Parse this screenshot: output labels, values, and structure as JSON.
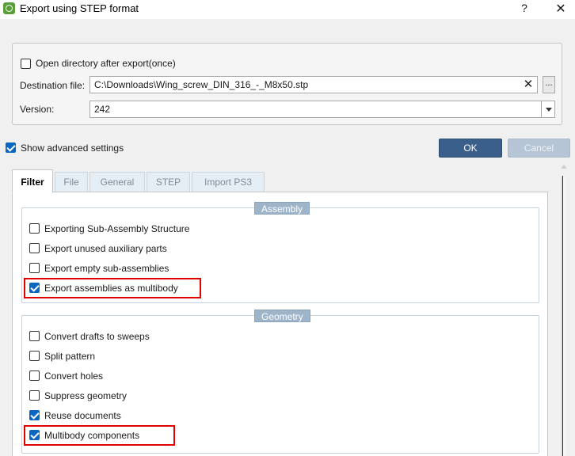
{
  "window": {
    "title": "Export using STEP format",
    "help_label": "?",
    "close_label": "✕"
  },
  "top": {
    "open_dir_label": "Open directory after export(once)",
    "open_dir_checked": false,
    "dest_label": "Destination file:",
    "dest_value": "C:\\Downloads\\Wing_screw_DIN_316_-_M8x50.stp",
    "clear_label": "✕",
    "browse_label": "...",
    "version_label": "Version:",
    "version_value": "242"
  },
  "advanced": {
    "label": "Show advanced settings",
    "checked": true
  },
  "buttons": {
    "ok": "OK",
    "cancel": "Cancel"
  },
  "tabs": [
    {
      "label": "Filter",
      "active": true
    },
    {
      "label": "File",
      "active": false
    },
    {
      "label": "General",
      "active": false
    },
    {
      "label": "STEP",
      "active": false
    },
    {
      "label": "Import PS3",
      "active": false
    }
  ],
  "assembly": {
    "title": "Assembly",
    "options": [
      {
        "label": "Exporting Sub-Assembly Structure",
        "checked": false
      },
      {
        "label": "Export unused auxiliary parts",
        "checked": false
      },
      {
        "label": "Export empty sub-assemblies",
        "checked": false
      },
      {
        "label": "Export assemblies as multibody",
        "checked": true
      }
    ]
  },
  "geometry": {
    "title": "Geometry",
    "options": [
      {
        "label": "Convert drafts to sweeps",
        "checked": false
      },
      {
        "label": "Split pattern",
        "checked": false
      },
      {
        "label": "Convert holes",
        "checked": false
      },
      {
        "label": "Suppress geometry",
        "checked": false
      },
      {
        "label": "Reuse documents",
        "checked": true
      },
      {
        "label": "Multibody components",
        "checked": true
      }
    ]
  },
  "colors": {
    "ok_button": "#3a5f8a",
    "cancel_button": "#b5c5d5",
    "checkbox_checked": "#0a66c2",
    "group_label": "#9db4c9",
    "highlight": "#e00000"
  }
}
